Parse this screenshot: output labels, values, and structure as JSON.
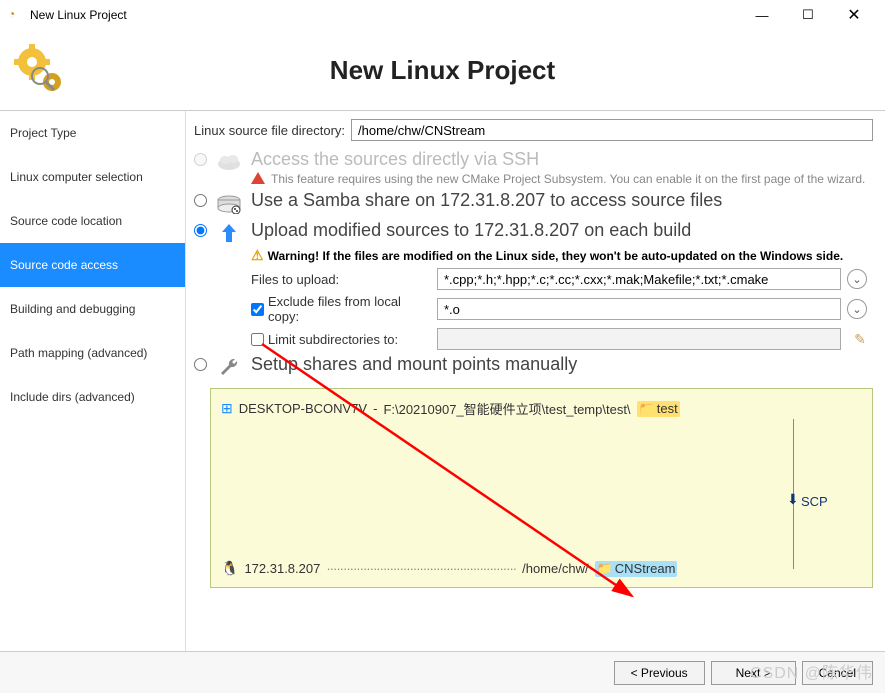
{
  "window": {
    "title": "New Linux Project"
  },
  "header": {
    "title": "New Linux Project"
  },
  "sidebar": {
    "items": [
      {
        "label": "Project Type"
      },
      {
        "label": "Linux computer selection"
      },
      {
        "label": "Source code location"
      },
      {
        "label": "Source code access",
        "selected": true
      },
      {
        "label": "Building and debugging"
      },
      {
        "label": "Path mapping (advanced)"
      },
      {
        "label": "Include dirs (advanced)"
      }
    ]
  },
  "directory": {
    "label": "Linux source file directory:",
    "value": "/home/chw/CNStream"
  },
  "options": {
    "ssh": {
      "title": "Access the sources directly via SSH",
      "sub": "This feature requires using the new CMake Project Subsystem. You can enable it on the first page of the wizard."
    },
    "samba": {
      "title": "Use a Samba share on 172.31.8.207 to access source files"
    },
    "upload": {
      "title": "Upload modified sources to 172.31.8.207 on each build",
      "warning": "Warning! If the files are modified on the Linux side, they won't be auto-updated on the Windows side."
    },
    "manual": {
      "title": "Setup shares and mount points manually"
    }
  },
  "cfg": {
    "files_label": "Files to upload:",
    "files_value": "*.cpp;*.h;*.hpp;*.c;*.cc;*.cxx;*.mak;Makefile;*.txt;*.cmake",
    "exclude_label": "Exclude files from local copy:",
    "exclude_value": "*.o",
    "limit_label": "Limit subdirectories to:",
    "limit_value": ""
  },
  "diagram": {
    "host": "DESKTOP-BCONV7V",
    "sep": " - ",
    "winpath": "F:\\20210907_智能硬件立项\\test_temp\\test\\",
    "winfolder": "test",
    "scp": "SCP",
    "linuxhost": "172.31.8.207",
    "linuxpath": "/home/chw/",
    "linuxfolder": "CNStream"
  },
  "footer": {
    "prev": "< Previous",
    "next": "Next >",
    "cancel": "Cancel"
  },
  "watermark": "CSDN @陈华伟"
}
